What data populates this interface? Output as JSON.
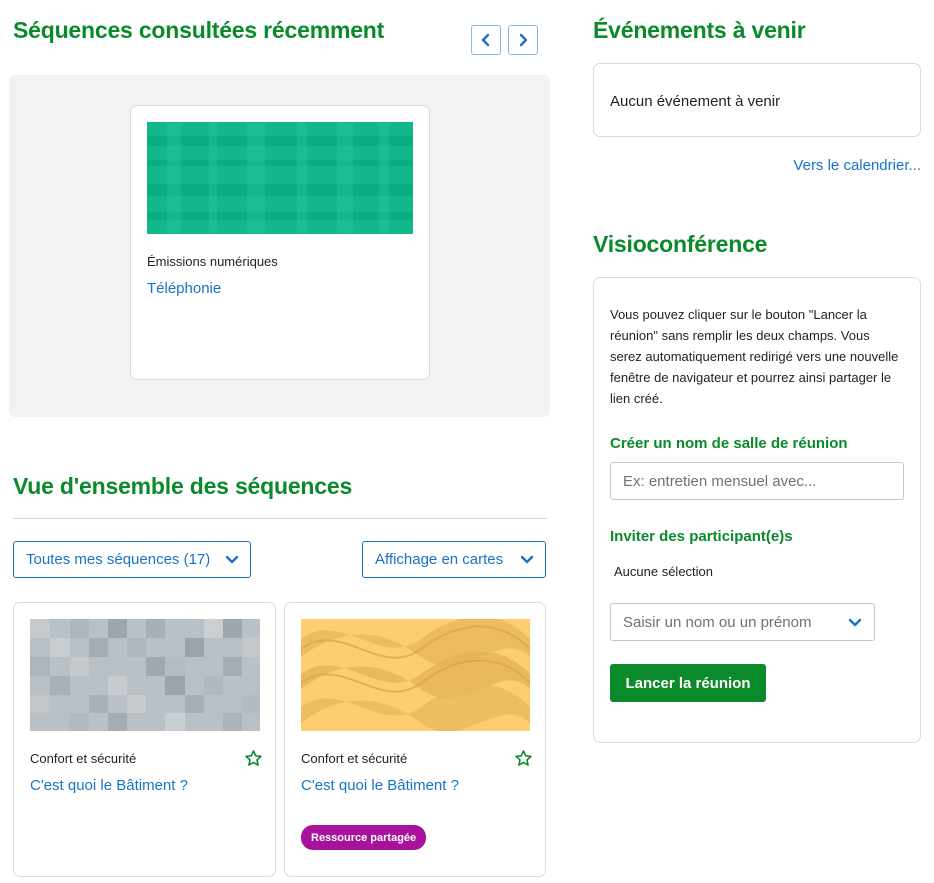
{
  "recent": {
    "title": "Séquences consultées récemment",
    "prev_icon": "chevron-left-icon",
    "next_icon": "chevron-right-icon",
    "card": {
      "category": "Émissions numériques",
      "name": "Téléphonie",
      "image_color": "#0fb88c"
    }
  },
  "overview": {
    "title": "Vue d'ensemble des séquences",
    "filter_label": "Toutes mes séquences (17)",
    "view_label": "Affichage en cartes",
    "courses": [
      {
        "category": "Confort et sécurité",
        "name": "C'est quoi le Bâtiment ?",
        "star_icon": "star-icon",
        "image_color": "#b9c0c6"
      },
      {
        "category": "Confort et sécurité",
        "name": "C'est quoi le Bâtiment ?",
        "star_icon": "star-icon",
        "badge": "Ressource partagée",
        "image_color": "#fcce6f"
      }
    ]
  },
  "events": {
    "title": "Événements à venir",
    "empty_text": "Aucun événement à venir",
    "calendar_link": "Vers le calendrier..."
  },
  "visio": {
    "title": "Visioconférence",
    "description": "Vous pouvez cliquer sur le bouton \"Lancer la réunion\" sans remplir les deux champs. Vous serez automatiquement redirigé vers une nouvelle fenêtre de navigateur et pourrez ainsi partager le lien créé.",
    "room_label": "Créer un nom de salle de réunion",
    "room_placeholder": "Ex: entretien mensuel avec...",
    "invite_label": "Inviter des participant(e)s",
    "no_selection": "Aucune sélection",
    "search_placeholder": "Saisir un nom ou un prénom",
    "launch_button": "Lancer la réunion"
  },
  "colors": {
    "accent_green": "#0b8a2b",
    "link_blue": "#1873c8",
    "badge_purple": "#a7119b"
  }
}
